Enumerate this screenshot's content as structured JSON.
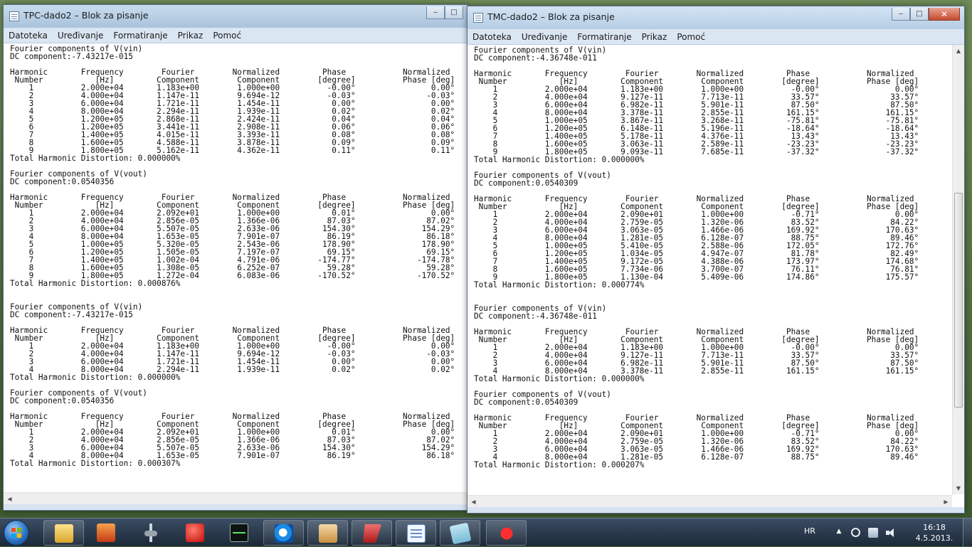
{
  "left_window": {
    "title": "TPC-dado2 – Blok za pisanje",
    "menu": [
      "Datoteka",
      "Uređivanje",
      "Formatiranje",
      "Prikaz",
      "Pomoć"
    ],
    "text": "Fourier components of V(vin)\nDC component:-7.43217e-015\n\nHarmonic       Frequency        Fourier        Normalized         Phase            Normalized\n Number           [Hz]         Component        Component        [degree]          Phase [deg]\n    1          2.000e+04       1.183e+00        1.000e+00          -0.00°                0.00°\n    2          4.000e+04       1.147e-11        9.694e-12          -0.03°               -0.03°\n    3          6.000e+04       1.721e-11        1.454e-11           0.00°                0.00°\n    4          8.000e+04       2.294e-11        1.939e-11           0.02°                0.02°\n    5          1.200e+05       2.868e-11        2.424e-11           0.04°                0.04°\n    6          1.200e+05       3.441e-11        2.908e-11           0.06°                0.06°\n    7          1.400e+05       4.015e-11        3.393e-11           0.08°                0.08°\n    8          1.600e+05       4.588e-11        3.878e-11           0.09°                0.09°\n    9          1.800e+05       5.162e-11        4.362e-11           0.11°                0.11°\nTotal Harmonic Distortion: 0.000000%\n\nFourier components of V(vout)\nDC component:0.0540356\n\nHarmonic       Frequency        Fourier        Normalized         Phase            Normalized\n Number           [Hz]         Component        Component        [degree]          Phase [deg]\n    1          2.000e+04       2.092e+01        1.000e+00           0.01°                0.00°\n    2          4.000e+04       2.856e-05        1.366e-06          87.03°               87.02°\n    3          6.000e+04       5.507e-05        2.633e-06         154.30°              154.29°\n    4          8.000e+04       1.653e-05        7.901e-07          86.19°               86.18°\n    5          1.000e+05       5.320e-05        2.543e-06         178.90°              178.90°\n    6          1.200e+05       1.505e-05        7.197e-07          69.15°               69.15°\n    7          1.400e+05       1.002e-04        4.791e-06        -174.77°             -174.78°\n    8          1.600e+05       1.308e-05        6.252e-07          59.28°               59.28°\n    9          1.800e+05       1.272e-04        6.083e-06        -170.52°             -170.52°\nTotal Harmonic Distortion: 0.000876%\n\n\nFourier components of V(vin)\nDC component:-7.43217e-015\n\nHarmonic       Frequency        Fourier        Normalized         Phase            Normalized\n Number           [Hz]         Component        Component        [degree]          Phase [deg]\n    1          2.000e+04       1.183e+00        1.000e+00          -0.00°                0.00°\n    2          4.000e+04       1.147e-11        9.694e-12          -0.03°               -0.03°\n    3          6.000e+04       1.721e-11        1.454e-11           0.00°                0.00°\n    4          8.000e+04       2.294e-11        1.939e-11           0.02°                0.02°\nTotal Harmonic Distortion: 0.000000%\n\nFourier components of V(vout)\nDC component:0.0540356\n\nHarmonic       Frequency        Fourier        Normalized         Phase            Normalized\n Number           [Hz]         Component        Component        [degree]          Phase [deg]\n    1          2.000e+04       2.092e+01        1.000e+00           0.01°                0.00°\n    2          4.000e+04       2.856e-05        1.366e-06          87.03°               87.02°\n    3          6.000e+04       5.507e-05        2.633e-06         154.30°              154.29°\n    4          8.000e+04       1.653e-05        7.901e-07          86.19°               86.18°\nTotal Harmonic Distortion: 0.000307%"
  },
  "right_window": {
    "title": "TMC-dado2 – Blok za pisanje",
    "menu": [
      "Datoteka",
      "Uređivanje",
      "Formatiranje",
      "Prikaz",
      "Pomoć"
    ],
    "text": "Fourier components of V(vin)\nDC component:-4.36748e-011\n\nHarmonic       Frequency        Fourier        Normalized         Phase            Normalized\n Number           [Hz]         Component        Component        [degree]          Phase [deg]\n    1          2.000e+04       1.183e+00        1.000e+00          -0.00°                0.00°\n    2          4.000e+04       9.127e-11        7.713e-11          33.57°               33.57°\n    3          6.000e+04       6.982e-11        5.901e-11          87.50°               87.50°\n    4          8.000e+04       3.378e-11        2.855e-11         161.15°              161.15°\n    5          1.000e+05       3.867e-11        3.268e-11         -75.81°              -75.81°\n    6          1.200e+05       6.148e-11        5.196e-11         -18.64°              -18.64°\n    7          1.400e+05       5.178e-11        4.376e-11          13.43°               13.43°\n    8          1.600e+05       3.063e-11        2.589e-11         -23.23°              -23.23°\n    9          1.800e+05       9.093e-11        7.685e-11         -37.32°              -37.32°\nTotal Harmonic Distortion: 0.000000%\n\nFourier components of V(vout)\nDC component:0.0540309\n\nHarmonic       Frequency        Fourier        Normalized         Phase            Normalized\n Number           [Hz]         Component        Component        [degree]          Phase [deg]\n    1          2.000e+04       2.090e+01        1.000e+00          -0.71°                0.00°\n    2          4.000e+04       2.759e-05        1.320e-06          83.52°               84.22°\n    3          6.000e+04       3.063e-05        1.466e-06         169.92°              170.63°\n    4          8.000e+04       1.281e-05        6.128e-07          88.75°               89.46°\n    5          1.000e+05       5.410e-05        2.588e-06         172.05°              172.76°\n    6          1.200e+05       1.034e-05        4.947e-07          81.78°               82.49°\n    7          1.400e+05       9.172e-05        4.388e-06         173.97°              174.68°\n    8          1.600e+05       7.734e-06        3.700e-07          76.11°               76.81°\n    9          1.800e+05       1.130e-04        5.409e-06         174.86°              175.57°\nTotal Harmonic Distortion: 0.000774%\n\n\nFourier components of V(vin)\nDC component:-4.36748e-011\n\nHarmonic       Frequency        Fourier        Normalized         Phase            Normalized\n Number           [Hz]         Component        Component        [degree]          Phase [deg]\n    1          2.000e+04       1.183e+00        1.000e+00          -0.00°                0.00°\n    2          4.000e+04       9.127e-11        7.713e-11          33.57°               33.57°\n    3          6.000e+04       6.982e-11        5.901e-11          87.50°               87.50°\n    4          8.000e+04       3.378e-11        2.855e-11         161.15°              161.15°\nTotal Harmonic Distortion: 0.000000%\n\nFourier components of V(vout)\nDC component:0.0540309\n\nHarmonic       Frequency        Fourier        Normalized         Phase            Normalized\n Number           [Hz]         Component        Component        [degree]          Phase [deg]\n    1          2.000e+04       2.090e+01        1.000e+00          -0.71°                0.00°\n    2          4.000e+04       2.759e-05        1.320e-06          83.52°               84.22°\n    3          6.000e+04       3.063e-05        1.466e-06         169.92°              170.63°\n    4          8.000e+04       1.281e-05        6.128e-07          88.75°               89.46°\nTotal Harmonic Distortion: 0.000207%"
  },
  "taskbar": {
    "icons": [
      "windows-start",
      "file-explorer",
      "magnifier",
      "probe-tool",
      "antivirus",
      "oscilloscope",
      "internet-explorer",
      "photo-viewer",
      "admin-tool",
      "document-viewer",
      "notepad",
      "paint"
    ],
    "language": "HR",
    "time": "16:18",
    "date": "4.5.2013."
  }
}
